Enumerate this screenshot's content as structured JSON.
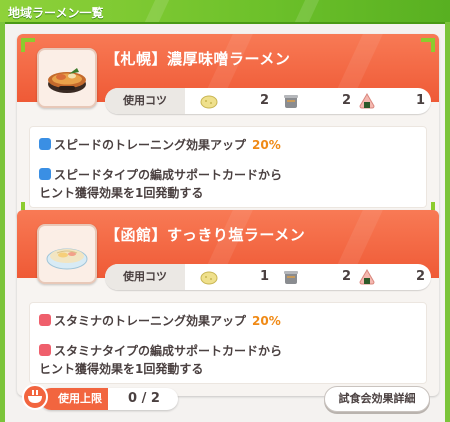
{
  "window": {
    "title": "地域ラーメン一覧"
  },
  "ramen": [
    {
      "title": "【札幌】濃厚味噌ラーメン",
      "tips_label": "使用コツ",
      "ingredients": [
        {
          "icon": "potato-icon",
          "count": "2"
        },
        {
          "icon": "pot-icon",
          "count": "2"
        },
        {
          "icon": "onigiri-icon",
          "count": "1"
        }
      ],
      "effect1": {
        "text": "スピードのトレーニング効果アップ",
        "pct": "20%",
        "type": "speed"
      },
      "effect2": {
        "line1": "スピードタイプの編成サポートカードから",
        "line2": "ヒント獲得効果を1回発動する"
      }
    },
    {
      "title": "【函館】すっきり塩ラーメン",
      "tips_label": "使用コツ",
      "ingredients": [
        {
          "icon": "potato-icon",
          "count": "1"
        },
        {
          "icon": "pot-icon",
          "count": "2"
        },
        {
          "icon": "onigiri-icon",
          "count": "2"
        }
      ],
      "effect1": {
        "text": "スタミナのトレーニング効果アップ",
        "pct": "20%",
        "type": "stamina"
      },
      "effect2": {
        "line1": "スタミナタイプの編成サポートカードから",
        "line2": "ヒント獲得効果を1回発動する"
      }
    }
  ],
  "footer": {
    "limit_label": "使用上限",
    "limit_value": "0 / 2",
    "detail_button": "試食会効果詳細"
  },
  "colors": {
    "header_green": "#6cc02a",
    "card_orange": "#ef5a36",
    "speed_blue": "#3a8fe4",
    "stamina_red": "#ef5f6c",
    "percent_orange": "#f08a16"
  }
}
